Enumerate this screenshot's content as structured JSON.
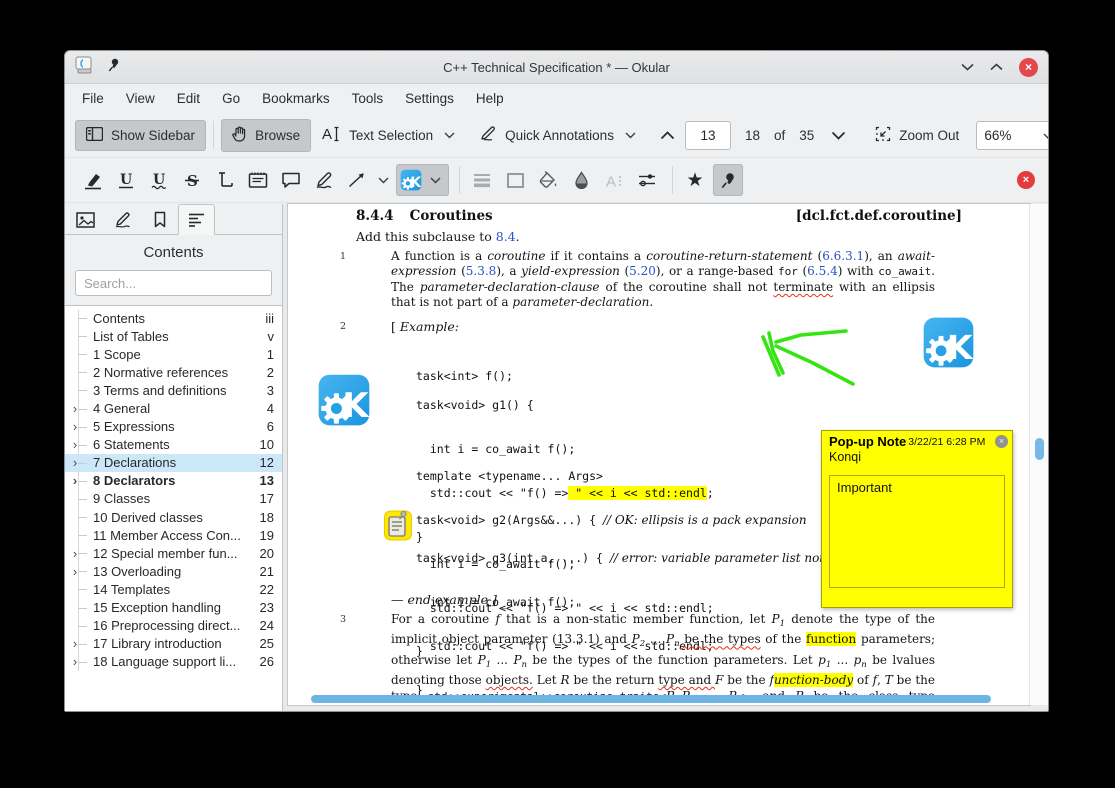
{
  "window": {
    "title": "C++ Technical Specification * — Okular"
  },
  "icons": {
    "star": "★",
    "close": "×"
  },
  "colors": {
    "accent_blue": "#3daee9",
    "kde_logo_blue": "#28a2e2",
    "highlight_yellow": "#ffff00",
    "note_yellow": "#ffff00",
    "close_red": "#e23c3c",
    "link_blue": "#2b50c8",
    "ink_green": "#35e512",
    "scrollbar_blue": "#6fb5e4"
  },
  "menu": {
    "items": [
      "File",
      "View",
      "Edit",
      "Go",
      "Bookmarks",
      "Tools",
      "Settings",
      "Help"
    ]
  },
  "toolbar": {
    "show_sidebar": "Show Sidebar",
    "browse": "Browse",
    "text_selection": "Text Selection",
    "quick_annotations": "Quick Annotations",
    "page_current": "13",
    "page_actual": "18",
    "page_of": "of",
    "page_total": "35",
    "zoom_out": "Zoom Out",
    "zoom_level": "66%"
  },
  "sidebar": {
    "title": "Contents",
    "search_placeholder": "Search...",
    "toc": [
      {
        "label": "Contents",
        "page": "iii"
      },
      {
        "label": "List of Tables",
        "page": "v"
      },
      {
        "label": "1 Scope",
        "page": "1"
      },
      {
        "label": "2 Normative references",
        "page": "2"
      },
      {
        "label": "3 Terms and definitions",
        "page": "3"
      },
      {
        "label": "4 General",
        "page": "4"
      },
      {
        "label": "5 Expressions",
        "page": "6"
      },
      {
        "label": "6 Statements",
        "page": "10"
      },
      {
        "label": "7 Declarations",
        "page": "12"
      },
      {
        "label": "8 Declarators",
        "page": "13"
      },
      {
        "label": "9 Classes",
        "page": "17"
      },
      {
        "label": "10 Derived classes",
        "page": "18"
      },
      {
        "label": "11 Member Access Con...",
        "page": "19"
      },
      {
        "label": "12 Special member fun...",
        "page": "20"
      },
      {
        "label": "13 Overloading",
        "page": "21"
      },
      {
        "label": "14 Templates",
        "page": "22"
      },
      {
        "label": "15 Exception handling",
        "page": "23"
      },
      {
        "label": "16 Preprocessing direct...",
        "page": "24"
      },
      {
        "label": "17 Library introduction",
        "page": "25"
      },
      {
        "label": "18 Language support li...",
        "page": "26"
      }
    ]
  },
  "document": {
    "heading_number": "8.4.4",
    "heading_title": "Coroutines",
    "heading_tag": "[dcl.fct.def.coroutine]",
    "subclause": [
      {
        "t": "Add this subclause to "
      },
      {
        "t": "8.4",
        "s": "link"
      },
      {
        "t": "."
      }
    ],
    "para1_num": "1",
    "para2_num": "2",
    "para3_num": "3",
    "para1": [
      {
        "t": "A function is a "
      },
      {
        "t": "coroutine",
        "s": "it"
      },
      {
        "t": " if it contains a "
      },
      {
        "t": "coroutine-return-statement",
        "s": "it"
      },
      {
        "t": " ("
      },
      {
        "t": "6.6.3.1",
        "s": "link"
      },
      {
        "t": "), an "
      },
      {
        "t": "await-expression",
        "s": "it"
      },
      {
        "t": " ("
      },
      {
        "t": "5.3.8",
        "s": "link"
      },
      {
        "t": "), a "
      },
      {
        "t": "yield-expression",
        "s": "it"
      },
      {
        "t": " ("
      },
      {
        "t": "5.20",
        "s": "link"
      },
      {
        "t": "), or a range-based "
      },
      {
        "t": "for",
        "s": "mono"
      },
      {
        "t": " ("
      },
      {
        "t": "6.5.4",
        "s": "link"
      },
      {
        "t": ") with "
      },
      {
        "t": "co_await",
        "s": "mono"
      },
      {
        "t": ". The "
      },
      {
        "t": "parameter-declaration-clause",
        "s": "it"
      },
      {
        "t": " of the coroutine shall not "
      },
      {
        "t": "terminate",
        "s": "squig"
      },
      {
        "t": " with an ellipsis that is not part of a "
      },
      {
        "t": "parameter-declaration",
        "s": "it"
      },
      {
        "t": "."
      }
    ],
    "example_open": [
      {
        "t": "[ "
      },
      {
        "t": "Example:",
        "s": "it"
      }
    ],
    "end_example": [
      {
        "t": "— end example",
        "s": "it"
      },
      {
        "t": " ]"
      }
    ],
    "codeA": {
      "0": [
        {
          "t": "task<int> f();"
        }
      ]
    },
    "codeB": {
      "0": [
        {
          "t": "task<void> g1() {"
        }
      ],
      "1": [
        {
          "t": "  int i = co_await f();"
        }
      ],
      "2": [
        {
          "t": "  std::cout << \"f() =>"
        },
        {
          "t": " \" << i << std::endl",
          "s": "hl"
        },
        {
          "t": ";"
        }
      ],
      "3": [
        {
          "t": "}"
        }
      ]
    },
    "codeC": {
      "0": [
        {
          "t": "template <typename... Args>"
        }
      ],
      "1": [
        {
          "t": "task<void> g2(Args&&...) { "
        },
        {
          "t": "// OK: ellipsis is a pack expansion",
          "s": "cmt"
        }
      ],
      "2": [
        {
          "t": "  int i = co_await f();"
        }
      ],
      "3": [
        {
          "t": "  std::cout << \"f() => \" << i << std::endl;"
        }
      ],
      "4": [
        {
          "t": "}"
        }
      ]
    },
    "codeD": {
      "0": [
        {
          "t": "task<void> g3(int a, ...) { "
        },
        {
          "t": "// error: variable parameter list not allowed",
          "s": "cmt"
        }
      ],
      "1": [
        {
          "t": "  int i = co_await f();"
        }
      ],
      "2": [
        {
          "t": "  std::cout << \"f() => \" << i << std::endl;"
        }
      ],
      "3": [
        {
          "t": "}"
        }
      ]
    },
    "para3": [
      {
        "t": "For a coroutine "
      },
      {
        "t": "f",
        "s": "it"
      },
      {
        "t": " that is a non-static member function, let "
      },
      {
        "t": "P",
        "s": "it"
      },
      {
        "t": "1",
        "s": "sub"
      },
      {
        "t": " denote the type of the implicit object parameter (13.3.1) and "
      },
      {
        "t": "P",
        "s": "it"
      },
      {
        "t": "2",
        "s": "sub"
      },
      {
        "t": " ... "
      },
      {
        "t": "P",
        "s": "it"
      },
      {
        "t": "n",
        "s": "sub"
      },
      {
        "t": " be the types",
        "s": "squig"
      },
      {
        "t": " of the "
      },
      {
        "t": "function",
        "s": "hl"
      },
      {
        "t": " parameters; otherwise let "
      },
      {
        "t": "P",
        "s": "it"
      },
      {
        "t": "1",
        "s": "sub"
      },
      {
        "t": " ... "
      },
      {
        "t": "P",
        "s": "it"
      },
      {
        "t": "n",
        "s": "sub"
      },
      {
        "t": " be the types of the function parameters. Let "
      },
      {
        "t": "p",
        "s": "it"
      },
      {
        "t": "1",
        "s": "sub"
      },
      {
        "t": " ... "
      },
      {
        "t": "p",
        "s": "it"
      },
      {
        "t": "n",
        "s": "sub"
      },
      {
        "t": " be lvalues denoting those "
      },
      {
        "t": "objects.",
        "s": "squig"
      },
      {
        "t": " Let "
      },
      {
        "t": "R",
        "s": "it"
      },
      {
        "t": " be the return "
      },
      {
        "t": "type and ",
        "s": "squig"
      },
      {
        "t": "F",
        "s": "it"
      },
      {
        "t": " be the "
      },
      {
        "t": "f",
        "s": "it"
      },
      {
        "t": "unction-body",
        "s": "it hl"
      },
      {
        "t": " of "
      },
      {
        "t": "f",
        "s": "it"
      },
      {
        "t": ", "
      },
      {
        "t": "T",
        "s": "it"
      },
      {
        "t": " be the type "
      },
      {
        "t": "std::experimental::coroutine_traits<",
        "s": "mono"
      },
      {
        "t": "R",
        "s": "it"
      },
      {
        "t": ",",
        "s": "mono"
      },
      {
        "t": "P",
        "s": "it"
      },
      {
        "t": "1",
        "s": "sub"
      },
      {
        "t": ",...,",
        "s": "mono"
      },
      {
        "t": "P",
        "s": "it"
      },
      {
        "t": "n",
        "s": "sub"
      },
      {
        "t": ">",
        "s": "mono"
      },
      {
        "t": ", and "
      },
      {
        "t": "P",
        "s": "it"
      },
      {
        "t": " be the class type denoted by"
      }
    ]
  },
  "popup_note": {
    "title": "Pop-up Note",
    "date": "3/22/21 6:28 PM",
    "author": "Konqi",
    "text": "Important"
  }
}
